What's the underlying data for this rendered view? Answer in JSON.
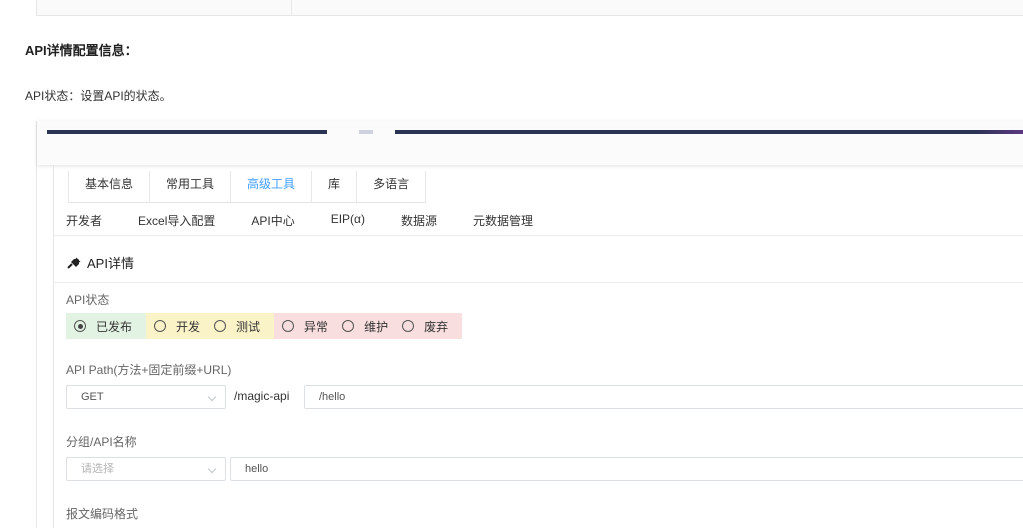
{
  "doc": {
    "heading": "API详情配置信息：",
    "description": "API状态：设置API的状态。"
  },
  "tabs": [
    {
      "label": "基本信息",
      "active": false
    },
    {
      "label": "常用工具",
      "active": false
    },
    {
      "label": "高级工具",
      "active": true
    },
    {
      "label": "库",
      "active": false
    },
    {
      "label": "多语言",
      "active": false
    }
  ],
  "subtabs": [
    "开发者",
    "Excel导入配置",
    "API中心",
    "EIP(α)",
    "数据源",
    "元数据管理"
  ],
  "section": {
    "title": "API详情",
    "icon": "plug-icon"
  },
  "api_status": {
    "label": "API状态",
    "selected": "已发布",
    "options": [
      {
        "label": "已发布",
        "checked": true,
        "color": "#e3f3e3"
      },
      {
        "label": "开发",
        "checked": false,
        "color": "#fbf3c8"
      },
      {
        "label": "测试",
        "checked": false,
        "color": "#fbf3c8"
      },
      {
        "label": "异常",
        "checked": false,
        "color": "#f8dede"
      },
      {
        "label": "维护",
        "checked": false,
        "color": "#f8dede"
      },
      {
        "label": "废弃",
        "checked": false,
        "color": "#f8dede"
      }
    ]
  },
  "api_path": {
    "label": "API Path(方法+固定前缀+URL)",
    "method": "GET",
    "prefix": "/magic-api",
    "url": "/hello"
  },
  "group_name": {
    "label": "分组/API名称",
    "group_placeholder": "请选择",
    "name": "hello"
  },
  "encoding": {
    "label": "报文编码格式"
  },
  "colors": {
    "active_tab": "#409eff",
    "highlight_border": "#e02020"
  }
}
